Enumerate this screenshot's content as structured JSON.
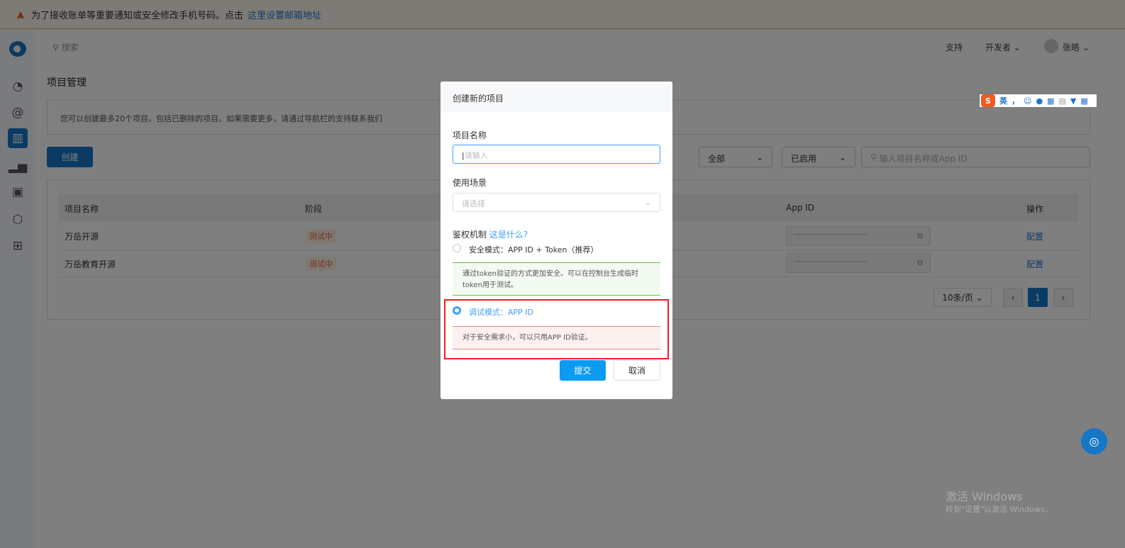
{
  "banner": {
    "text": "为了接收账单等重要通知或安全修改手机号码。点击",
    "link": "这里设置邮箱地址"
  },
  "header": {
    "search_placeholder": "搜索",
    "support": "支持",
    "developer": "开发者",
    "user": "张皓"
  },
  "page": {
    "title": "项目管理",
    "info": "您可以创建最多20个项目，包括已删除的项目。如果需要更多，请通过导航栏的支持联系我们",
    "create": "创建",
    "filter_type": "全部",
    "filter_status": "已启用",
    "search_placeholder": "输入项目名称或App ID"
  },
  "table": {
    "headers": [
      "项目名称",
      "阶段",
      "App ID",
      "操作"
    ],
    "rows": [
      {
        "name": "万岳开源",
        "stage": "测试中",
        "app_id": "--------------------------------",
        "action": "配置"
      },
      {
        "name": "万岳教育开源",
        "stage": "测试中",
        "app_id": "--------------------------------",
        "action": "配置"
      }
    ]
  },
  "pagination": {
    "page_size": "10条/页",
    "current": "1",
    "prev": "‹",
    "next": "›"
  },
  "modal": {
    "title": "创建新的项目",
    "name_label": "项目名称",
    "name_placeholder": "请输入",
    "scene_label": "使用场景",
    "scene_placeholder": "请选择",
    "auth_label": "鉴权机制",
    "auth_help": "这是什么?",
    "option1": "安全模式：APP ID + Token（推荐）",
    "option1_desc": "通过token验证的方式更加安全。可以在控制台生成临时token用于测试。",
    "option2": "调试模式：APP ID",
    "option2_desc": "对于安全需求小，可以只用APP ID验证。",
    "submit": "提交",
    "cancel": "取消"
  },
  "ime": {
    "lang": "英",
    "punct": "，"
  },
  "watermark": {
    "line1": "激活 Windows",
    "line2": "转到\"设置\"以激活 Windows。"
  }
}
